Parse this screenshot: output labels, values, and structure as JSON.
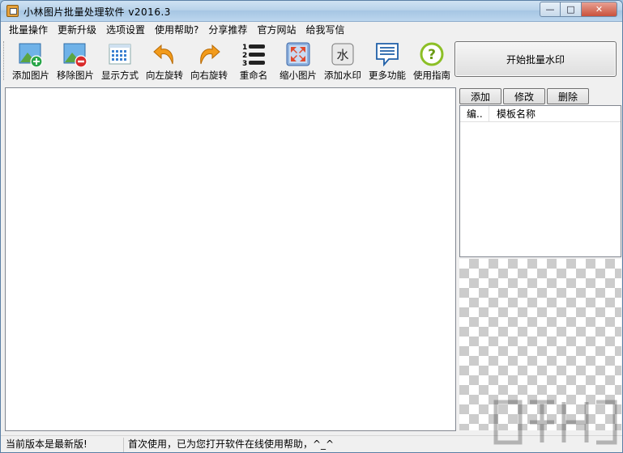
{
  "window": {
    "title": "小林图片批量处理软件 v2016.3",
    "caption": {
      "minimize": "—",
      "maximize": "□",
      "close": "✕"
    }
  },
  "menu": [
    "批量操作",
    "更新升级",
    "选项设置",
    "使用帮助?",
    "分享推荐",
    "官方网站",
    "给我写信"
  ],
  "toolbar": [
    {
      "label": "添加图片",
      "icon": "add-image-icon"
    },
    {
      "label": "移除图片",
      "icon": "remove-image-icon"
    },
    {
      "label": "显示方式",
      "icon": "view-mode-icon"
    },
    {
      "label": "向左旋转",
      "icon": "rotate-left-icon"
    },
    {
      "label": "向右旋转",
      "icon": "rotate-right-icon"
    },
    {
      "label": "重命名",
      "icon": "rename-list-icon"
    },
    {
      "label": "缩小图片",
      "icon": "shrink-image-icon"
    },
    {
      "label": "添加水印",
      "icon": "watermark-icon"
    },
    {
      "label": "更多功能",
      "icon": "more-features-icon"
    },
    {
      "label": "使用指南",
      "icon": "help-guide-icon"
    }
  ],
  "actions": {
    "start_watermark": "开始批量水印"
  },
  "template": {
    "buttons": {
      "add": "添加",
      "edit": "修改",
      "delete": "删除"
    },
    "columns": {
      "num": "编..",
      "name": "模板名称"
    }
  },
  "status": {
    "version": "当前版本是最新版!",
    "message": "首次使用，已为您打开软件在线使用帮助，^_^"
  },
  "colors": {
    "accent": "#1e6fc9",
    "rotate": "#f29b1b",
    "add": "#2aa64a",
    "remove": "#d92b2b",
    "help": "#8cbf26"
  }
}
